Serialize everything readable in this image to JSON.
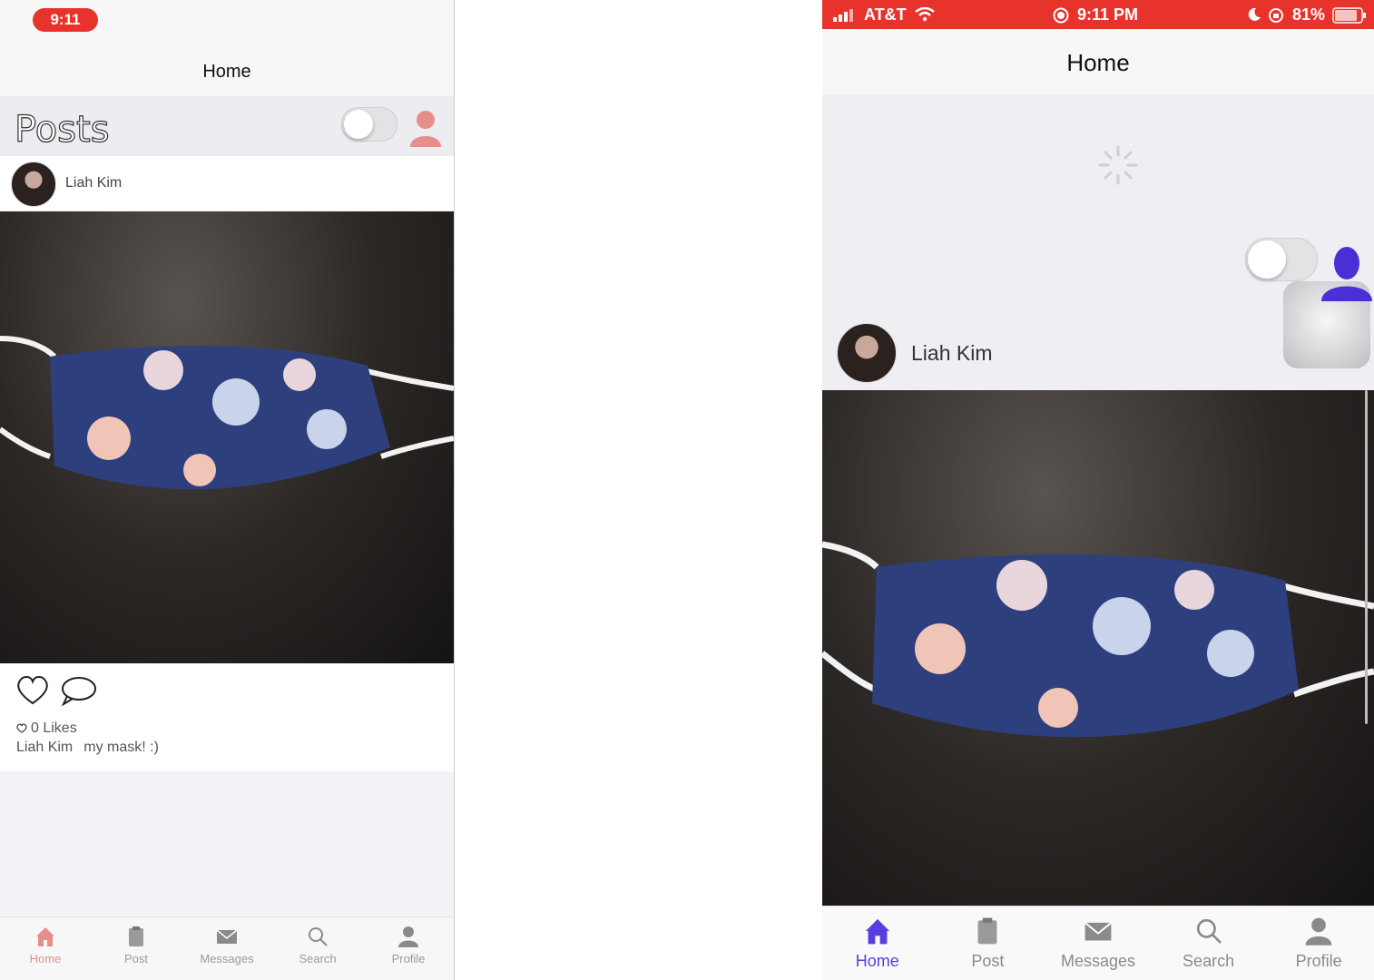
{
  "left": {
    "status_time": "9:11",
    "nav_title": "Home",
    "posts_title": "Posts",
    "post": {
      "author": "Liah Kim",
      "likes": "0 Likes",
      "caption_author": "Liah Kim",
      "caption_text": "my mask! :)"
    },
    "tabs": [
      {
        "label": "Home",
        "icon": "home-icon",
        "active": true
      },
      {
        "label": "Post",
        "icon": "clipboard-icon",
        "active": false
      },
      {
        "label": "Messages",
        "icon": "envelope-icon",
        "active": false
      },
      {
        "label": "Search",
        "icon": "magnifier-icon",
        "active": false
      },
      {
        "label": "Profile",
        "icon": "person-icon",
        "active": false
      }
    ]
  },
  "right": {
    "status": {
      "carrier": "AT&T",
      "time": "9:11 PM",
      "battery": "81%"
    },
    "nav_title": "Home",
    "post": {
      "author": "Liah Kim"
    },
    "tabs": [
      {
        "label": "Home",
        "icon": "home-icon",
        "active": true
      },
      {
        "label": "Post",
        "icon": "clipboard-icon",
        "active": false
      },
      {
        "label": "Messages",
        "icon": "envelope-icon",
        "active": false
      },
      {
        "label": "Search",
        "icon": "magnifier-icon",
        "active": false
      },
      {
        "label": "Profile",
        "icon": "person-icon",
        "active": false
      }
    ]
  },
  "colors": {
    "status_red": "#e8332d",
    "left_accent": "#e88e8a",
    "right_accent": "#5a3de0",
    "profile_icon_purple": "#4a2fd6"
  }
}
